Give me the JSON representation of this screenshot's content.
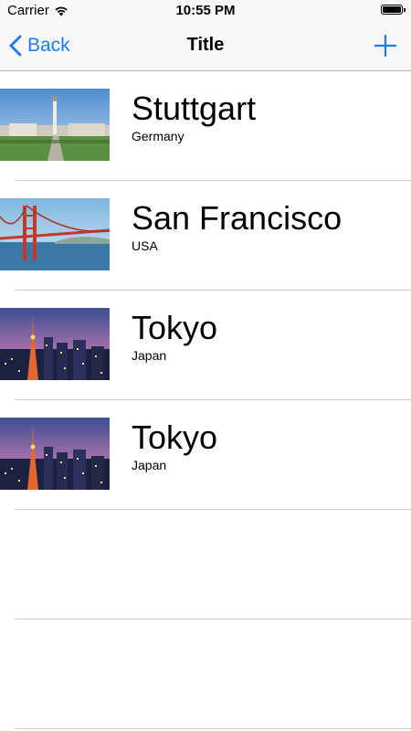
{
  "status_bar": {
    "carrier": "Carrier",
    "time": "10:55 PM",
    "wifi_icon": "wifi-icon",
    "battery_icon": "battery-icon"
  },
  "nav_bar": {
    "back_label": "Back",
    "title": "Title",
    "add_icon": "plus-icon",
    "accent_color": "#1b7ef7"
  },
  "list": {
    "items": [
      {
        "city": "Stuttgart",
        "country": "Germany"
      },
      {
        "city": "San Francisco",
        "country": "USA"
      },
      {
        "city": "Tokyo",
        "country": "Japan"
      },
      {
        "city": "Tokyo",
        "country": "Japan"
      }
    ]
  }
}
